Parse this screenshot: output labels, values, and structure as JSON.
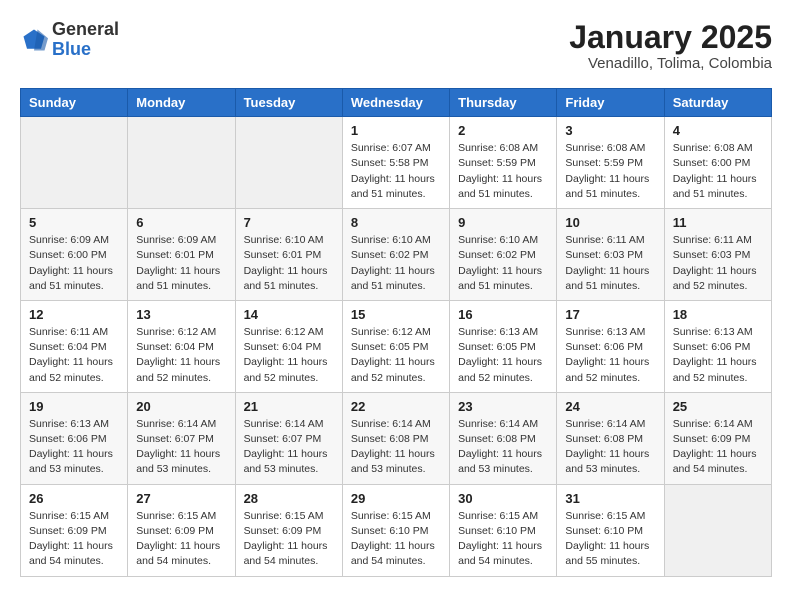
{
  "header": {
    "logo_general": "General",
    "logo_blue": "Blue",
    "month": "January 2025",
    "location": "Venadillo, Tolima, Colombia"
  },
  "days_of_week": [
    "Sunday",
    "Monday",
    "Tuesday",
    "Wednesday",
    "Thursday",
    "Friday",
    "Saturday"
  ],
  "weeks": [
    [
      {
        "day": "",
        "info": ""
      },
      {
        "day": "",
        "info": ""
      },
      {
        "day": "",
        "info": ""
      },
      {
        "day": "1",
        "info": "Sunrise: 6:07 AM\nSunset: 5:58 PM\nDaylight: 11 hours\nand 51 minutes."
      },
      {
        "day": "2",
        "info": "Sunrise: 6:08 AM\nSunset: 5:59 PM\nDaylight: 11 hours\nand 51 minutes."
      },
      {
        "day": "3",
        "info": "Sunrise: 6:08 AM\nSunset: 5:59 PM\nDaylight: 11 hours\nand 51 minutes."
      },
      {
        "day": "4",
        "info": "Sunrise: 6:08 AM\nSunset: 6:00 PM\nDaylight: 11 hours\nand 51 minutes."
      }
    ],
    [
      {
        "day": "5",
        "info": "Sunrise: 6:09 AM\nSunset: 6:00 PM\nDaylight: 11 hours\nand 51 minutes."
      },
      {
        "day": "6",
        "info": "Sunrise: 6:09 AM\nSunset: 6:01 PM\nDaylight: 11 hours\nand 51 minutes."
      },
      {
        "day": "7",
        "info": "Sunrise: 6:10 AM\nSunset: 6:01 PM\nDaylight: 11 hours\nand 51 minutes."
      },
      {
        "day": "8",
        "info": "Sunrise: 6:10 AM\nSunset: 6:02 PM\nDaylight: 11 hours\nand 51 minutes."
      },
      {
        "day": "9",
        "info": "Sunrise: 6:10 AM\nSunset: 6:02 PM\nDaylight: 11 hours\nand 51 minutes."
      },
      {
        "day": "10",
        "info": "Sunrise: 6:11 AM\nSunset: 6:03 PM\nDaylight: 11 hours\nand 51 minutes."
      },
      {
        "day": "11",
        "info": "Sunrise: 6:11 AM\nSunset: 6:03 PM\nDaylight: 11 hours\nand 52 minutes."
      }
    ],
    [
      {
        "day": "12",
        "info": "Sunrise: 6:11 AM\nSunset: 6:04 PM\nDaylight: 11 hours\nand 52 minutes."
      },
      {
        "day": "13",
        "info": "Sunrise: 6:12 AM\nSunset: 6:04 PM\nDaylight: 11 hours\nand 52 minutes."
      },
      {
        "day": "14",
        "info": "Sunrise: 6:12 AM\nSunset: 6:04 PM\nDaylight: 11 hours\nand 52 minutes."
      },
      {
        "day": "15",
        "info": "Sunrise: 6:12 AM\nSunset: 6:05 PM\nDaylight: 11 hours\nand 52 minutes."
      },
      {
        "day": "16",
        "info": "Sunrise: 6:13 AM\nSunset: 6:05 PM\nDaylight: 11 hours\nand 52 minutes."
      },
      {
        "day": "17",
        "info": "Sunrise: 6:13 AM\nSunset: 6:06 PM\nDaylight: 11 hours\nand 52 minutes."
      },
      {
        "day": "18",
        "info": "Sunrise: 6:13 AM\nSunset: 6:06 PM\nDaylight: 11 hours\nand 52 minutes."
      }
    ],
    [
      {
        "day": "19",
        "info": "Sunrise: 6:13 AM\nSunset: 6:06 PM\nDaylight: 11 hours\nand 53 minutes."
      },
      {
        "day": "20",
        "info": "Sunrise: 6:14 AM\nSunset: 6:07 PM\nDaylight: 11 hours\nand 53 minutes."
      },
      {
        "day": "21",
        "info": "Sunrise: 6:14 AM\nSunset: 6:07 PM\nDaylight: 11 hours\nand 53 minutes."
      },
      {
        "day": "22",
        "info": "Sunrise: 6:14 AM\nSunset: 6:08 PM\nDaylight: 11 hours\nand 53 minutes."
      },
      {
        "day": "23",
        "info": "Sunrise: 6:14 AM\nSunset: 6:08 PM\nDaylight: 11 hours\nand 53 minutes."
      },
      {
        "day": "24",
        "info": "Sunrise: 6:14 AM\nSunset: 6:08 PM\nDaylight: 11 hours\nand 53 minutes."
      },
      {
        "day": "25",
        "info": "Sunrise: 6:14 AM\nSunset: 6:09 PM\nDaylight: 11 hours\nand 54 minutes."
      }
    ],
    [
      {
        "day": "26",
        "info": "Sunrise: 6:15 AM\nSunset: 6:09 PM\nDaylight: 11 hours\nand 54 minutes."
      },
      {
        "day": "27",
        "info": "Sunrise: 6:15 AM\nSunset: 6:09 PM\nDaylight: 11 hours\nand 54 minutes."
      },
      {
        "day": "28",
        "info": "Sunrise: 6:15 AM\nSunset: 6:09 PM\nDaylight: 11 hours\nand 54 minutes."
      },
      {
        "day": "29",
        "info": "Sunrise: 6:15 AM\nSunset: 6:10 PM\nDaylight: 11 hours\nand 54 minutes."
      },
      {
        "day": "30",
        "info": "Sunrise: 6:15 AM\nSunset: 6:10 PM\nDaylight: 11 hours\nand 54 minutes."
      },
      {
        "day": "31",
        "info": "Sunrise: 6:15 AM\nSunset: 6:10 PM\nDaylight: 11 hours\nand 55 minutes."
      },
      {
        "day": "",
        "info": ""
      }
    ]
  ]
}
